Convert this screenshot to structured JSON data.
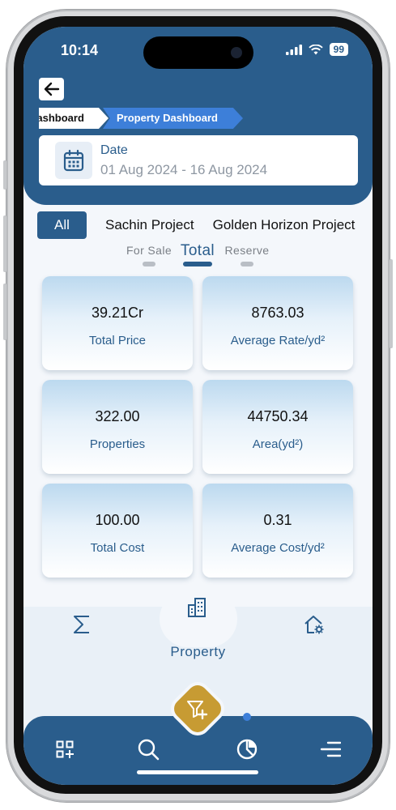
{
  "status": {
    "time": "10:14",
    "battery": "99"
  },
  "breadcrumb": {
    "previous": "Dashboard",
    "current": "Property Dashboard"
  },
  "date_filter": {
    "label": "Date",
    "value": "01 Aug 2024 - 16 Aug 2024"
  },
  "projects": {
    "tabs": [
      "All",
      "Sachin Project",
      "Golden Horizon Project"
    ],
    "active": "All"
  },
  "sale_tabs": {
    "tabs": [
      "For Sale",
      "Total",
      "Reserve"
    ],
    "active": "Total"
  },
  "stats": [
    {
      "value": "39.21Cr",
      "label": "Total Price"
    },
    {
      "value": "8763.03",
      "label": "Average Rate/yd²"
    },
    {
      "value": "322.00",
      "label": "Properties"
    },
    {
      "value": "44750.34",
      "label": "Area(yd²)"
    },
    {
      "value": "100.00",
      "label": "Total Cost"
    },
    {
      "value": "0.31",
      "label": "Average Cost/yd²"
    }
  ],
  "property_nav": {
    "title": "Property",
    "icons": [
      "sigma-icon",
      "building-icon",
      "home-settings-icon"
    ]
  },
  "tab_bar": {
    "icons": [
      "grid-add-icon",
      "search-icon",
      "pie-chart-icon",
      "menu-icon"
    ],
    "fab_icon": "filter-add-icon"
  },
  "colors": {
    "primary": "#2a5d8c",
    "accent": "#3d7fd9",
    "gold": "#c79b33"
  }
}
